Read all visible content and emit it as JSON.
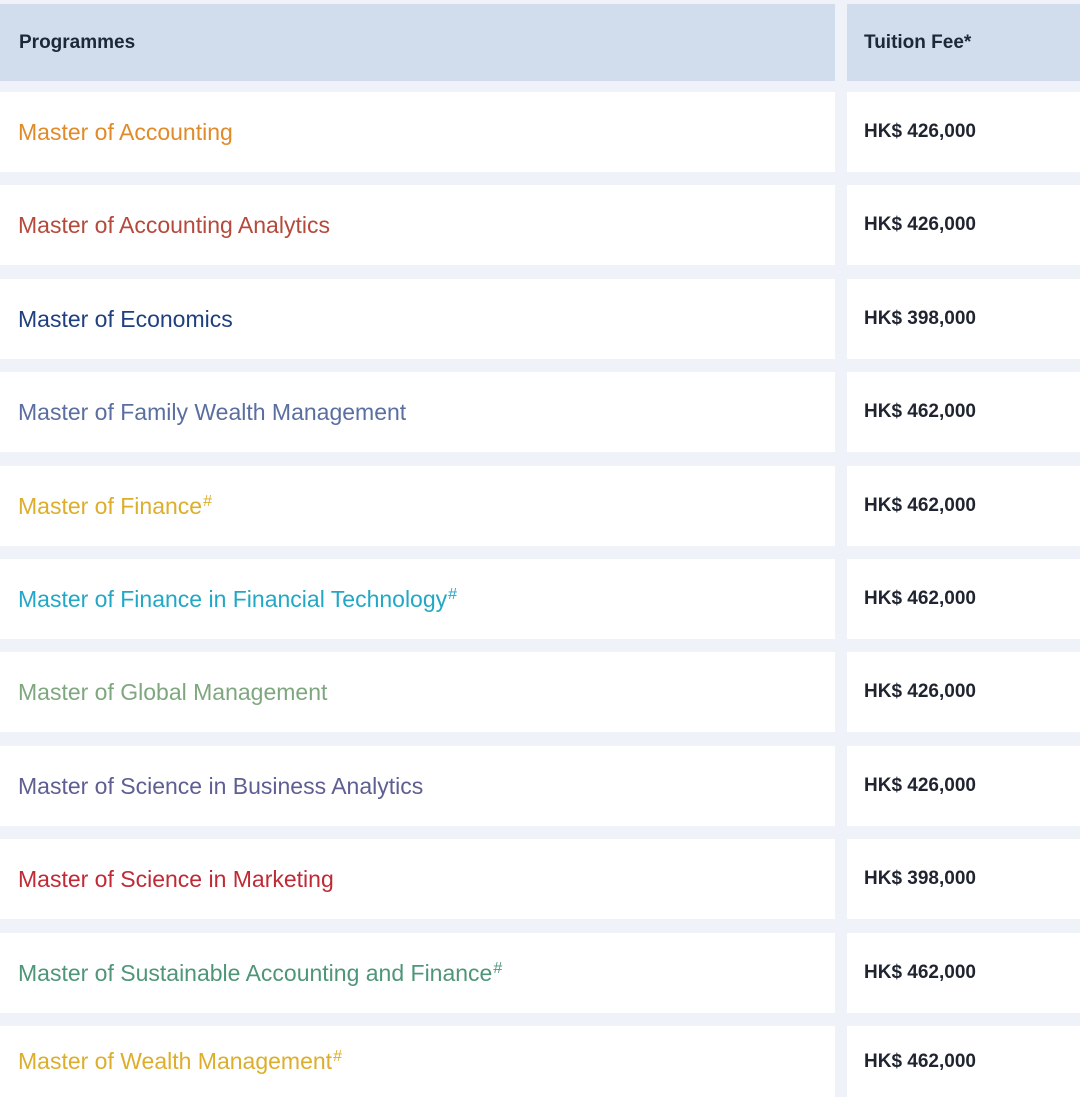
{
  "header": {
    "programmes_label": "Programmes",
    "fee_label": "Tuition Fee*"
  },
  "rows": [
    {
      "name": "Master of Accounting",
      "mark": "",
      "fee": "HK$ 426,000",
      "color": "#e08a2a"
    },
    {
      "name": "Master of Accounting Analytics",
      "mark": "",
      "fee": "HK$ 426,000",
      "color": "#b5493b"
    },
    {
      "name": "Master of Economics",
      "mark": "",
      "fee": "HK$ 398,000",
      "color": "#1f3f7f"
    },
    {
      "name": "Master of Family Wealth Management",
      "mark": "",
      "fee": "HK$ 462,000",
      "color": "#5a6ea0"
    },
    {
      "name": "Master of Finance",
      "mark": "#",
      "fee": "HK$ 462,000",
      "color": "#dcae2c"
    },
    {
      "name": "Master of Finance in Financial Technology",
      "mark": "#",
      "fee": "HK$ 462,000",
      "color": "#22a8c6"
    },
    {
      "name": "Master of Global Management",
      "mark": "",
      "fee": "HK$ 426,000",
      "color": "#7fa77f"
    },
    {
      "name": "Master of Science in Business Analytics",
      "mark": "",
      "fee": "HK$ 426,000",
      "color": "#5e5e92"
    },
    {
      "name": "Master of Science in Marketing",
      "mark": "",
      "fee": "HK$ 398,000",
      "color": "#c02a36"
    },
    {
      "name": "Master of Sustainable Accounting and Finance",
      "mark": "#",
      "fee": "HK$ 462,000",
      "color": "#4f9679"
    },
    {
      "name": "Master of Wealth Management",
      "mark": "#",
      "fee": "HK$ 462,000",
      "color": "#dcae2c"
    }
  ]
}
